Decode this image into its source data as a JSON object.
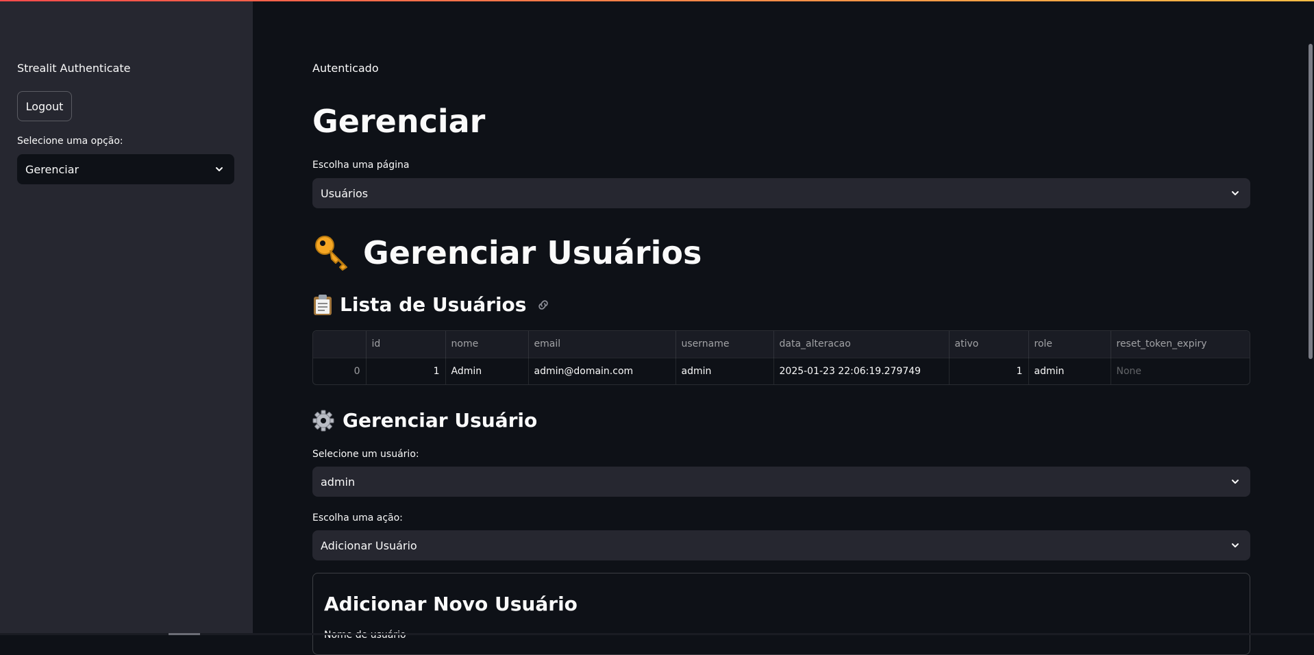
{
  "sidebar": {
    "title": "Strealit Authenticate",
    "logout_label": "Logout",
    "select_label": "Selecione uma opção:",
    "select_value": "Gerenciar"
  },
  "main": {
    "status_text": "Autenticado",
    "page_title": "Gerenciar",
    "page_select_label": "Escolha uma página",
    "page_select_value": "Usuários",
    "section_title": "Gerenciar Usuários",
    "section_icon": "key-icon",
    "list_title": "Lista de Usuários",
    "list_icon": "clipboard-icon",
    "table": {
      "columns": [
        "",
        "id",
        "nome",
        "email",
        "username",
        "data_alteracao",
        "ativo",
        "role",
        "reset_token_expiry"
      ],
      "rows": [
        [
          "0",
          "1",
          "Admin",
          "admin@domain.com",
          "admin",
          "2025-01-23 22:06:19.279749",
          "1",
          "admin",
          "None"
        ]
      ]
    },
    "manage_title": "Gerenciar Usuário",
    "manage_icon": "gear-icon",
    "user_select_label": "Selecione um usuário:",
    "user_select_value": "admin",
    "action_select_label": "Escolha uma ação:",
    "action_select_value": "Adicionar Usuário",
    "form_title": "Adicionar Novo Usuário",
    "form_field_label": "Nome de usuário"
  },
  "colors": {
    "background": "#0e1117",
    "sidebar": "#262730",
    "input": "#262730",
    "text": "#fafafa",
    "accent_start": "#ff4b4b",
    "accent_end": "#ffbd45"
  }
}
